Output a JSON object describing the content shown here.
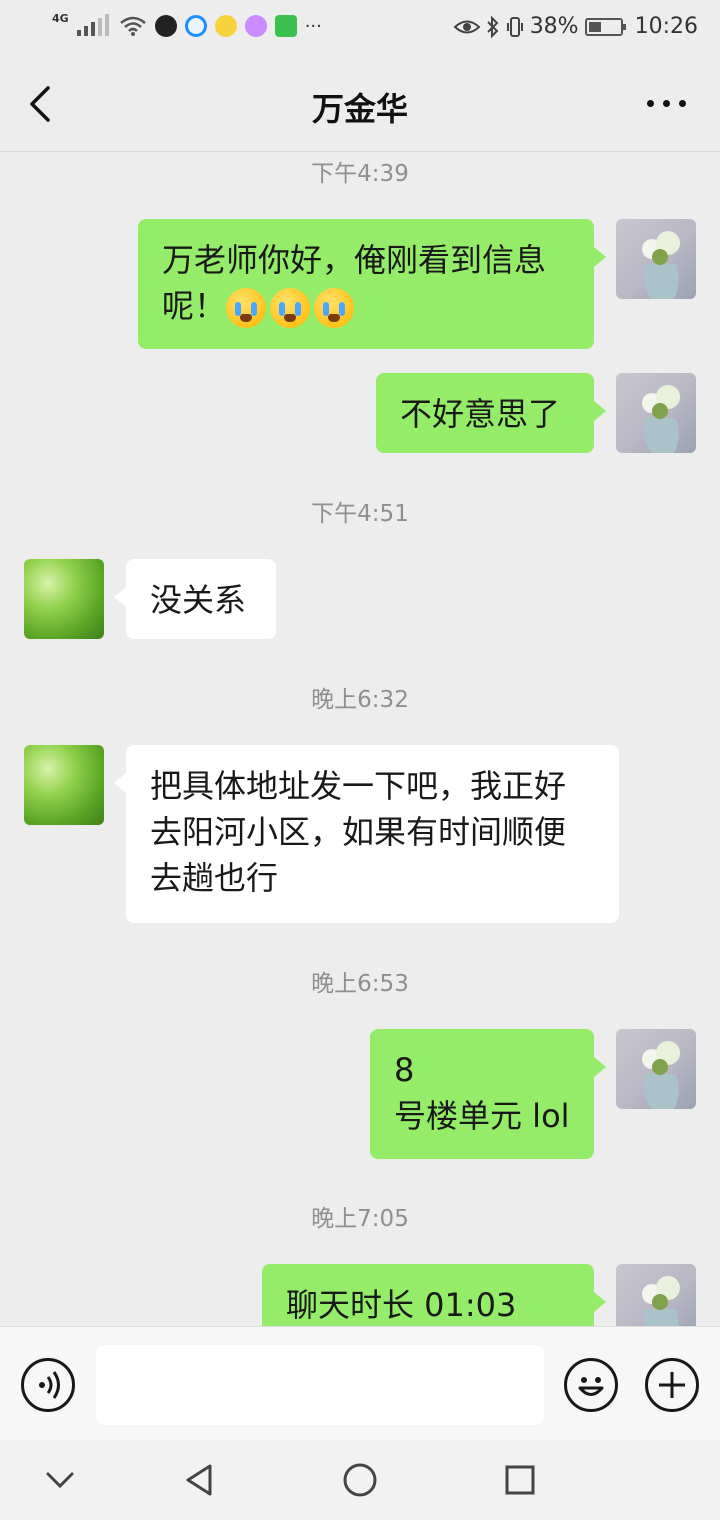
{
  "status_bar": {
    "network": "4G",
    "battery": "38%",
    "time": "10:26",
    "overflow": "···"
  },
  "header": {
    "title": "万金华"
  },
  "messages": [
    {
      "type": "time",
      "text": "下午4:39"
    },
    {
      "type": "me",
      "lines": [
        "万老师你好，俺刚看到信息",
        "呢！"
      ],
      "emoji_count": 3
    },
    {
      "type": "me",
      "lines": [
        "不好意思了"
      ]
    },
    {
      "type": "time",
      "text": "下午4:51"
    },
    {
      "type": "other",
      "lines": [
        "没关系"
      ]
    },
    {
      "type": "time",
      "text": "晚上6:32"
    },
    {
      "type": "other",
      "lines": [
        "把具体地址发一下吧，我正好",
        "去阳河小区，如果有时间顺便",
        "去趟也行"
      ]
    },
    {
      "type": "time",
      "text": "晚上6:53"
    },
    {
      "type": "me",
      "lines": [
        "8",
        "号楼单元 lol"
      ]
    },
    {
      "type": "time",
      "text": "晚上7:05"
    },
    {
      "type": "me",
      "lines": [
        "聊天时长 01:03"
      ],
      "icon": "hang-up-phone-icon"
    }
  ],
  "input_bar": {
    "value": "",
    "icons": [
      "voice-icon",
      "emoji-face-icon",
      "plus-icon"
    ]
  },
  "nav_bar": {
    "icons": [
      "nav-collapse-icon",
      "nav-back-icon",
      "nav-home-icon",
      "nav-recents-icon"
    ]
  },
  "colors": {
    "background": "#ededed",
    "my_bubble": "#95ec69",
    "other_bubble": "#ffffff",
    "time_text": "#8f8f8f"
  }
}
